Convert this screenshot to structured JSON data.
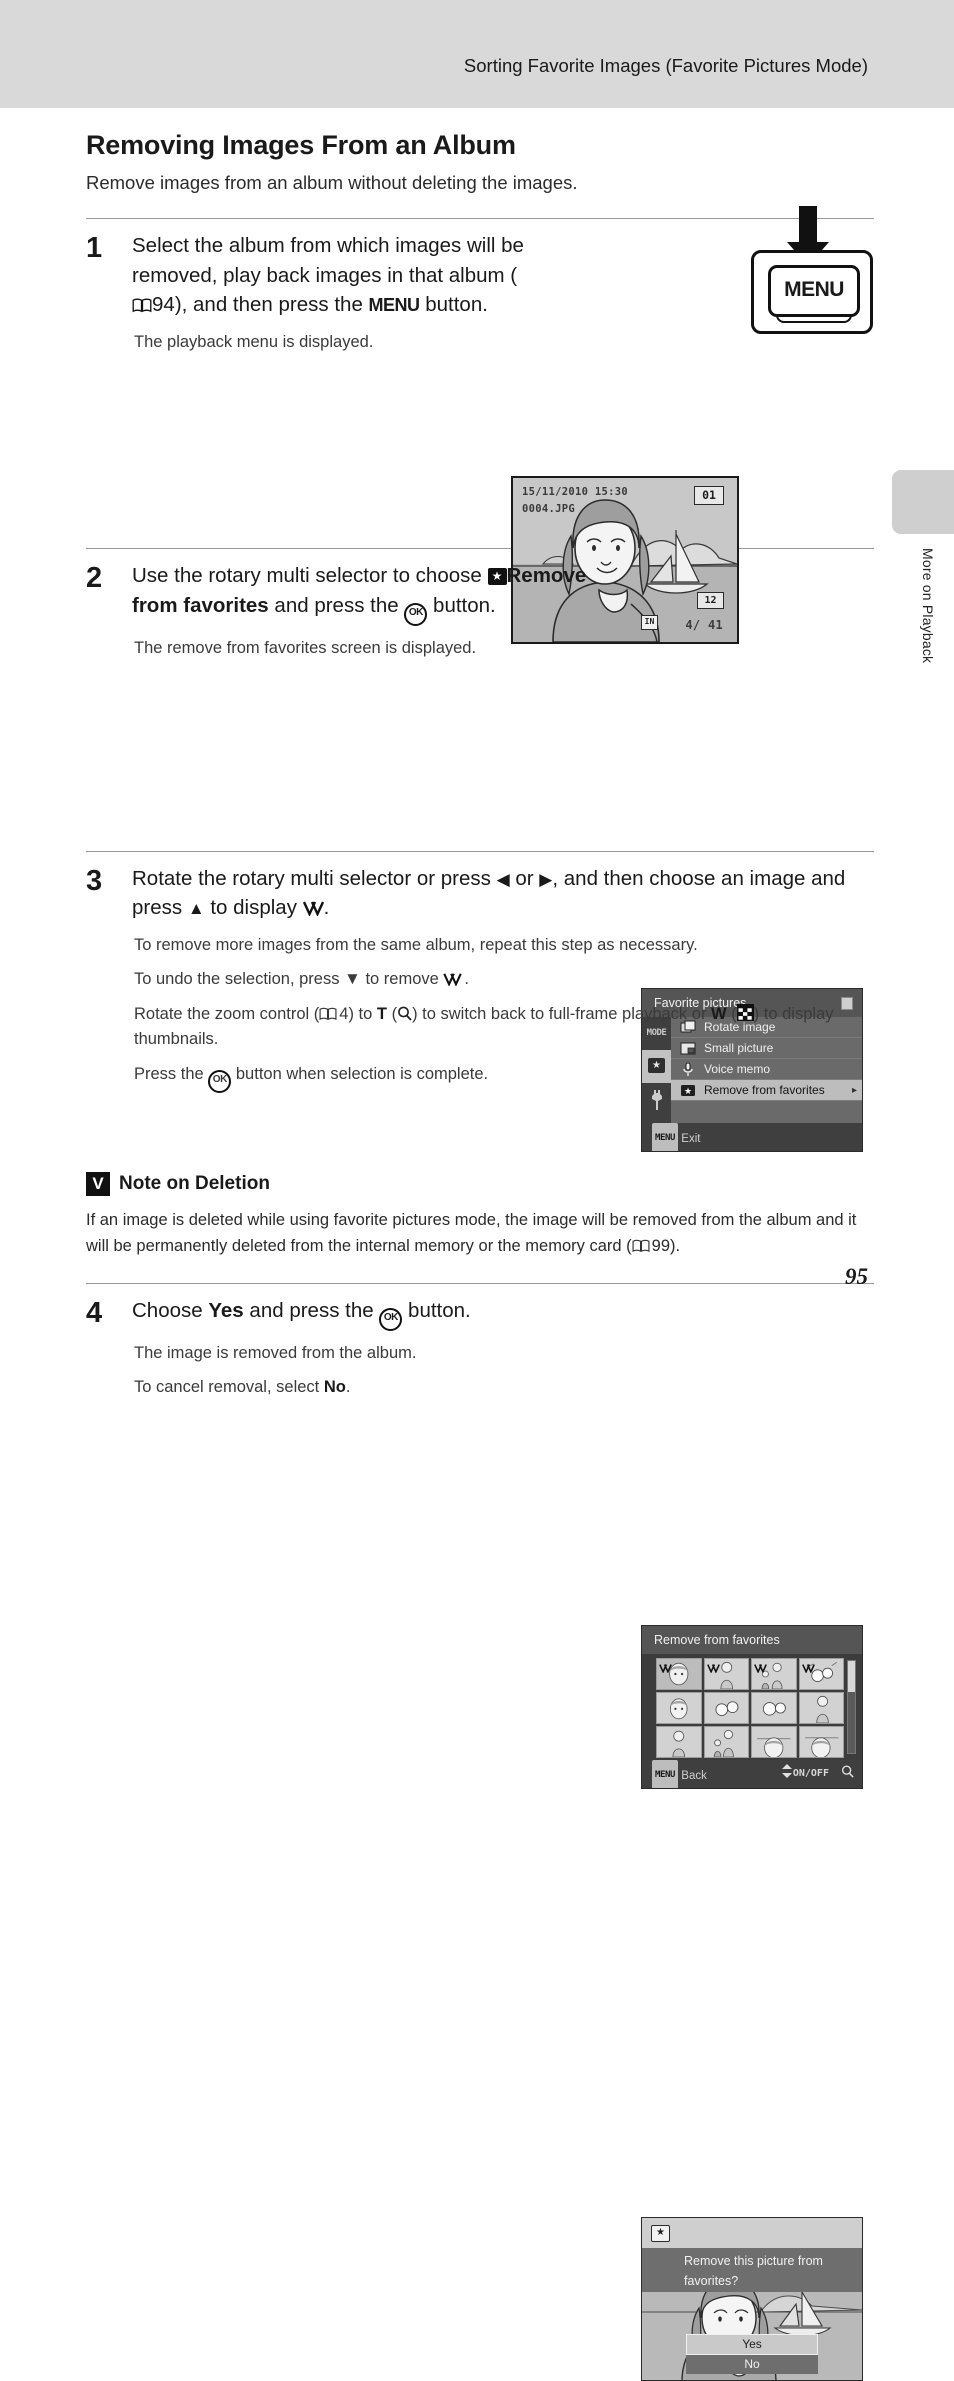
{
  "header": {
    "running_title": "Sorting Favorite Images (Favorite Pictures Mode)"
  },
  "section": {
    "title": "Removing Images From an Album",
    "intro": "Remove images from an album without deleting the images."
  },
  "steps": [
    {
      "number": "1",
      "lead_parts": {
        "a": "Select the album from which images will be removed, play back images in that album (",
        "ref": "94",
        "b": "), and then press the ",
        "menu": "MENU",
        "c": " button."
      },
      "notes": [
        "The playback menu is displayed."
      ]
    },
    {
      "number": "2",
      "lead_parts": {
        "a": "Use the rotary multi selector to choose ",
        "bold": "Remove from favorites",
        "b": " and press the ",
        "c": " button."
      },
      "notes": [
        "The remove from favorites screen is displayed."
      ]
    },
    {
      "number": "3",
      "lead_parts": {
        "a": "Rotate the rotary multi selector or press ",
        "left": "◀",
        "b": " or ",
        "right": "▶",
        "c": ", and then choose an image and press ",
        "up": "▲",
        "d": " to display ",
        "e": "."
      },
      "notes": [
        "To remove more images from the same album, repeat this step as necessary.",
        "To undo the selection, press ▼ to remove ✓.",
        "Rotate the zoom control (⎙ 4) to T (⌕) to switch back to full-frame playback or W (▦) to display thumbnails.",
        "Press the OK button when selection is complete."
      ],
      "note3_parts": {
        "a": "To undo the selection, press ",
        "down": "▼",
        "b": " to remove ",
        "c": "."
      },
      "note4_parts": {
        "a": "Rotate the zoom control (",
        "ref": "4",
        "b": ") to ",
        "T": "T",
        "c": " (",
        "d": ") to switch back to full-frame playback or ",
        "W": "W",
        "e": " (",
        "f": ") to display thumbnails."
      },
      "note5_parts": {
        "a": "Press the ",
        "b": " button when selection is complete."
      }
    },
    {
      "number": "4",
      "lead_parts": {
        "a": "Choose ",
        "yes": "Yes",
        "b": " and press the ",
        "c": " button."
      },
      "notes_parts": [
        {
          "a": "The image is removed from the album."
        },
        {
          "a": "To cancel removal, select ",
          "no": "No",
          "b": "."
        }
      ]
    }
  ],
  "figure_lcd_photo": {
    "datetime": "15/11/2010 15:30",
    "filename": "0004.JPG",
    "album_badge": "01",
    "image_size_badge": "12",
    "image_size_sub": "M",
    "internal_memory": "IN",
    "frame_counter": "4/   41"
  },
  "figure_menu_button": {
    "label": "MENU"
  },
  "figure_menu_screen": {
    "title": "Favorite pictures",
    "tabs": [
      "MODE",
      "favorites-tab",
      "setup-tab"
    ],
    "tab_mode_label": "MODE",
    "items": [
      {
        "label": "Rotate image",
        "icon": "rotate-image-icon",
        "selected": false
      },
      {
        "label": "Small picture",
        "icon": "small-picture-icon",
        "selected": false
      },
      {
        "label": "Voice memo",
        "icon": "voice-memo-icon",
        "selected": false
      },
      {
        "label": "Remove from favorites",
        "icon": "remove-from-favorites-icon",
        "selected": true
      }
    ],
    "footer_key": "MENU",
    "footer_label": "Exit"
  },
  "figure_thumb_screen": {
    "title": "Remove from favorites",
    "footer_key": "MENU",
    "footer_label": "Back",
    "footer_right": "ON/OFF",
    "thumbnails": [
      {
        "checked": true,
        "active": true
      },
      {
        "checked": true,
        "active": false
      },
      {
        "checked": true,
        "active": false
      },
      {
        "checked": true,
        "active": false
      },
      {
        "checked": false,
        "active": false
      },
      {
        "checked": false,
        "active": false
      },
      {
        "checked": false,
        "active": false
      },
      {
        "checked": false,
        "active": false
      },
      {
        "checked": false,
        "active": false
      },
      {
        "checked": false,
        "active": false
      },
      {
        "checked": false,
        "active": false
      },
      {
        "checked": false,
        "active": false
      }
    ]
  },
  "figure_confirm_screen": {
    "message_line1": "Remove this picture from",
    "message_line2": "favorites?",
    "yes_label": "Yes",
    "no_label": "No"
  },
  "side_tab": {
    "label": "More on Playback"
  },
  "note": {
    "title": "Note on Deletion",
    "body_a": "If an image is deleted while using favorite pictures mode, the image will be removed from the album and it will be permanently deleted from the internal memory or the memory card (",
    "ref": "99",
    "body_b": ")."
  },
  "page_number": "95"
}
